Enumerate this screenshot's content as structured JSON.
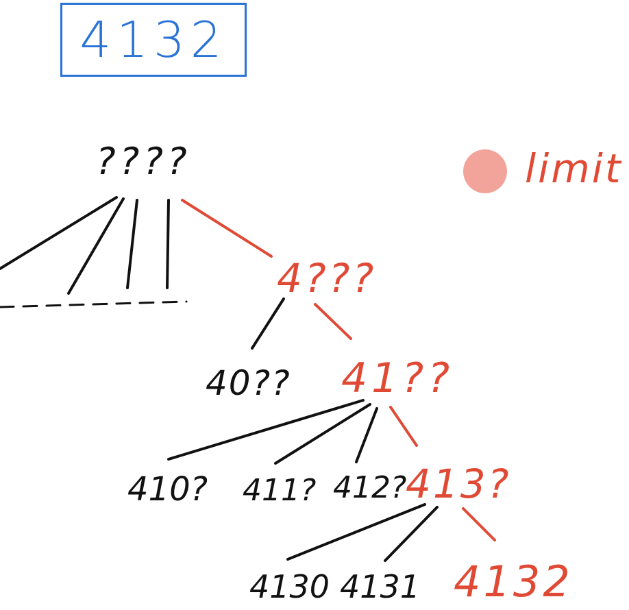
{
  "target_number": "4132",
  "legend": {
    "label": "limit",
    "color": "#f2a49a"
  },
  "colors": {
    "normal": "#111111",
    "limit": "#e04a35",
    "target": "#2a73d6"
  },
  "tree": {
    "root": "????",
    "level1": "4???",
    "level2": [
      "40??",
      "41??"
    ],
    "level3": [
      "410?",
      "411?",
      "412?",
      "413?"
    ],
    "level4": [
      "4130",
      "4131",
      "4132"
    ]
  }
}
